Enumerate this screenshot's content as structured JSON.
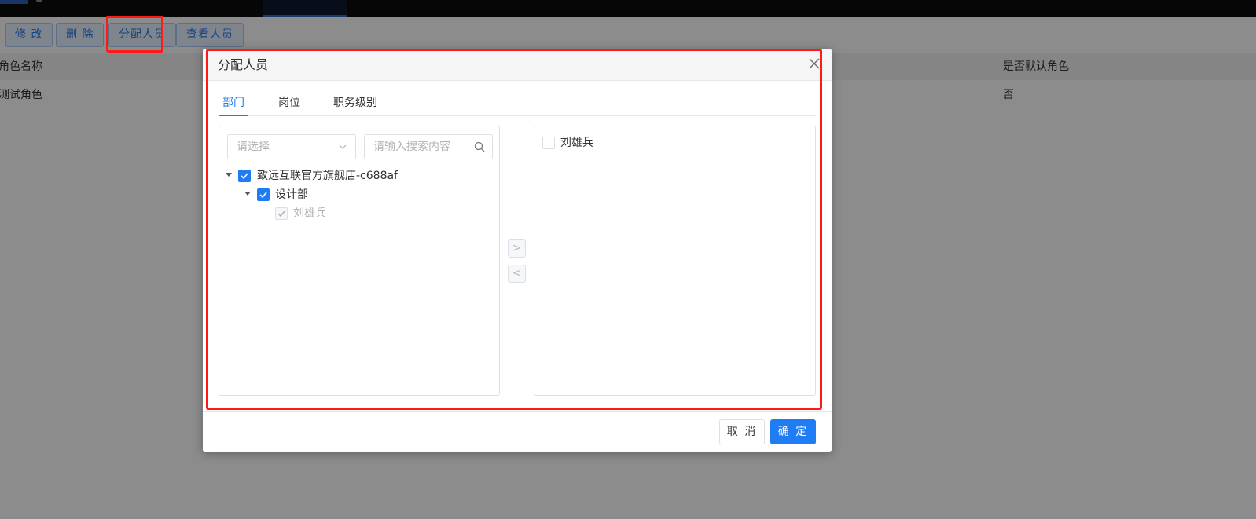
{
  "toolbar": {
    "edit_label": "修 改",
    "delete_label": "删 除",
    "assign_label": "分配人员",
    "view_label": "查看人员"
  },
  "table": {
    "columns": [
      "角色名称",
      "是否默认角色"
    ],
    "rows": [
      {
        "name": "测试角色",
        "is_default": "否"
      }
    ]
  },
  "dialog": {
    "title": "分配人员",
    "tabs": [
      {
        "label": "部门",
        "active": true
      },
      {
        "label": "岗位",
        "active": false
      },
      {
        "label": "职务级别",
        "active": false
      }
    ],
    "left_panel": {
      "select_placeholder": "请选择",
      "search_placeholder": "请输入搜索内容",
      "tree": [
        {
          "label": "致远互联官方旗舰店-c688af",
          "checked": true,
          "expanded": true,
          "children": [
            {
              "label": "设计部",
              "checked": true,
              "expanded": true,
              "children": [
                {
                  "label": "刘雄兵",
                  "checked": true,
                  "disabled": true
                }
              ]
            }
          ]
        }
      ]
    },
    "transfer_right_label": ">",
    "transfer_left_label": "<",
    "right_panel": {
      "items": [
        {
          "label": "刘雄兵",
          "checked": false
        }
      ]
    },
    "cancel_label": "取 消",
    "confirm_label": "确 定"
  },
  "colors": {
    "accent": "#1f7cf3",
    "highlight": "#ff1a1a"
  }
}
